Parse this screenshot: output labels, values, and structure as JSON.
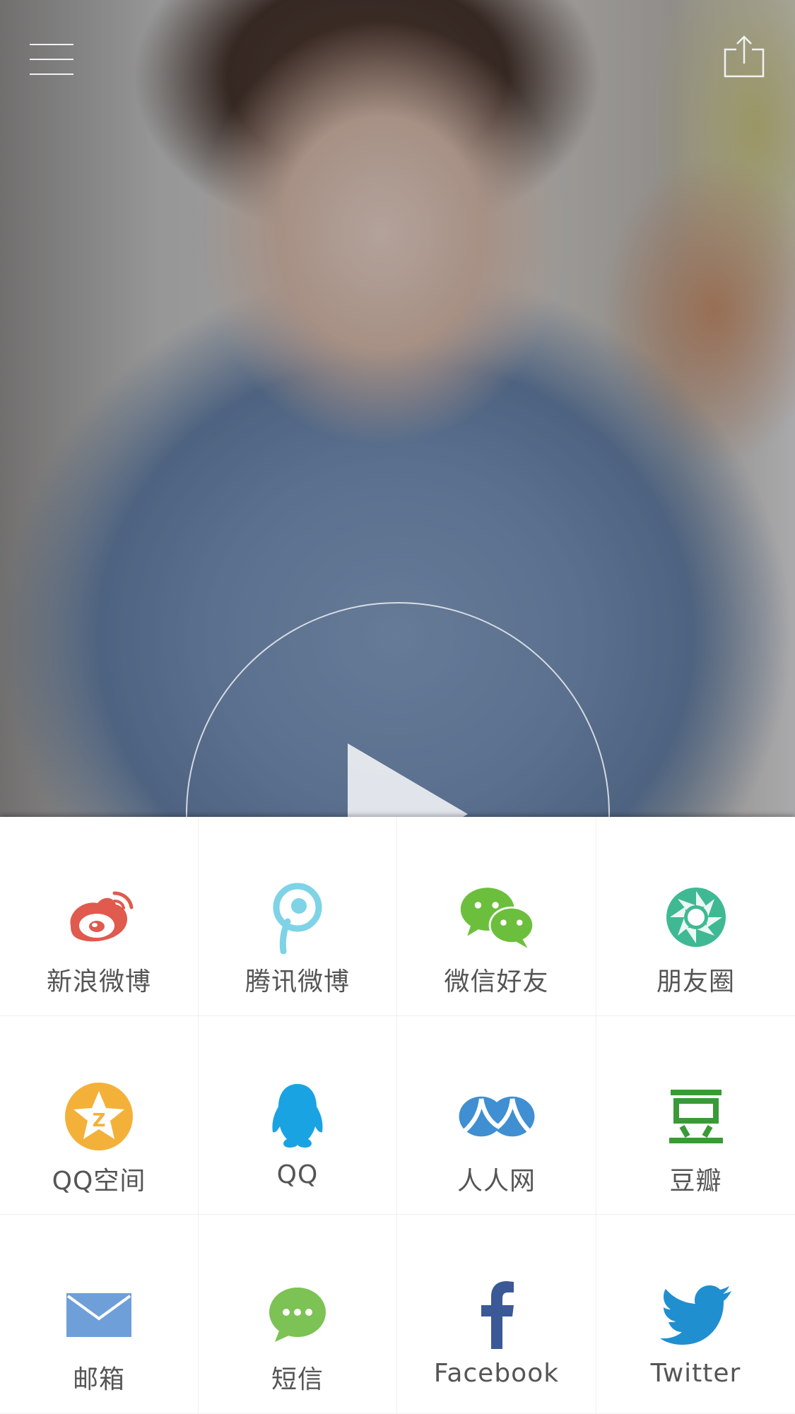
{
  "colors": {
    "weibo": "#e05a4e",
    "tencent_weibo": "#7ed3e6",
    "wechat": "#6cbf3c",
    "moments": "#3fb993",
    "qzone": "#f3b13a",
    "qq": "#1aa3e3",
    "renren": "#3f8fd2",
    "douban": "#3a9a36",
    "mail": "#6e9fd8",
    "sms": "#7cc254",
    "facebook": "#3b5997",
    "twitter": "#1f8fd0",
    "label": "#555555"
  },
  "video": {
    "menu_icon": "hamburger-menu-icon",
    "share_icon": "share-upload-icon",
    "play_icon": "play-icon"
  },
  "share_options": [
    {
      "label": "新浪微博",
      "icon": "sina-weibo-icon"
    },
    {
      "label": "腾讯微博",
      "icon": "tencent-weibo-icon"
    },
    {
      "label": "微信好友",
      "icon": "wechat-icon"
    },
    {
      "label": "朋友圈",
      "icon": "moments-icon"
    },
    {
      "label": "QQ空间",
      "icon": "qzone-icon"
    },
    {
      "label": "QQ",
      "icon": "qq-icon"
    },
    {
      "label": "人人网",
      "icon": "renren-icon"
    },
    {
      "label": "豆瓣",
      "icon": "douban-icon"
    },
    {
      "label": "邮箱",
      "icon": "mail-icon"
    },
    {
      "label": "短信",
      "icon": "sms-icon"
    },
    {
      "label": "Facebook",
      "icon": "facebook-icon"
    },
    {
      "label": "Twitter",
      "icon": "twitter-icon"
    }
  ]
}
